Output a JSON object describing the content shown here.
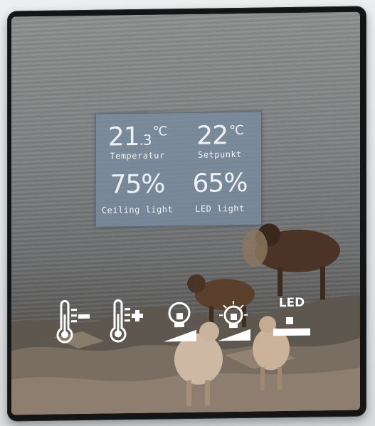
{
  "display": {
    "temperature": {
      "value_main": "21",
      "value_decimal": ".3",
      "unit": "°C",
      "label": "Temperatur"
    },
    "setpoint": {
      "value": "22",
      "unit": "°C",
      "label": "Setpunkt"
    },
    "ceiling_light": {
      "value": "75%",
      "label": "Ceiling light"
    },
    "led_light": {
      "value": "65%",
      "label": "LED light"
    }
  },
  "buttons": [
    {
      "icon": "thermometer-minus-icon"
    },
    {
      "icon": "thermometer-plus-icon"
    },
    {
      "icon": "ceiling-light-dim-icon"
    },
    {
      "icon": "ceiling-light-bright-icon"
    },
    {
      "icon": "led-dim-icon",
      "label": "LED"
    }
  ],
  "colors": {
    "bezel": "#141414",
    "lcd_panel": "#788ca0",
    "lcd_text": "#eef1f4",
    "icon": "#ffffff"
  }
}
